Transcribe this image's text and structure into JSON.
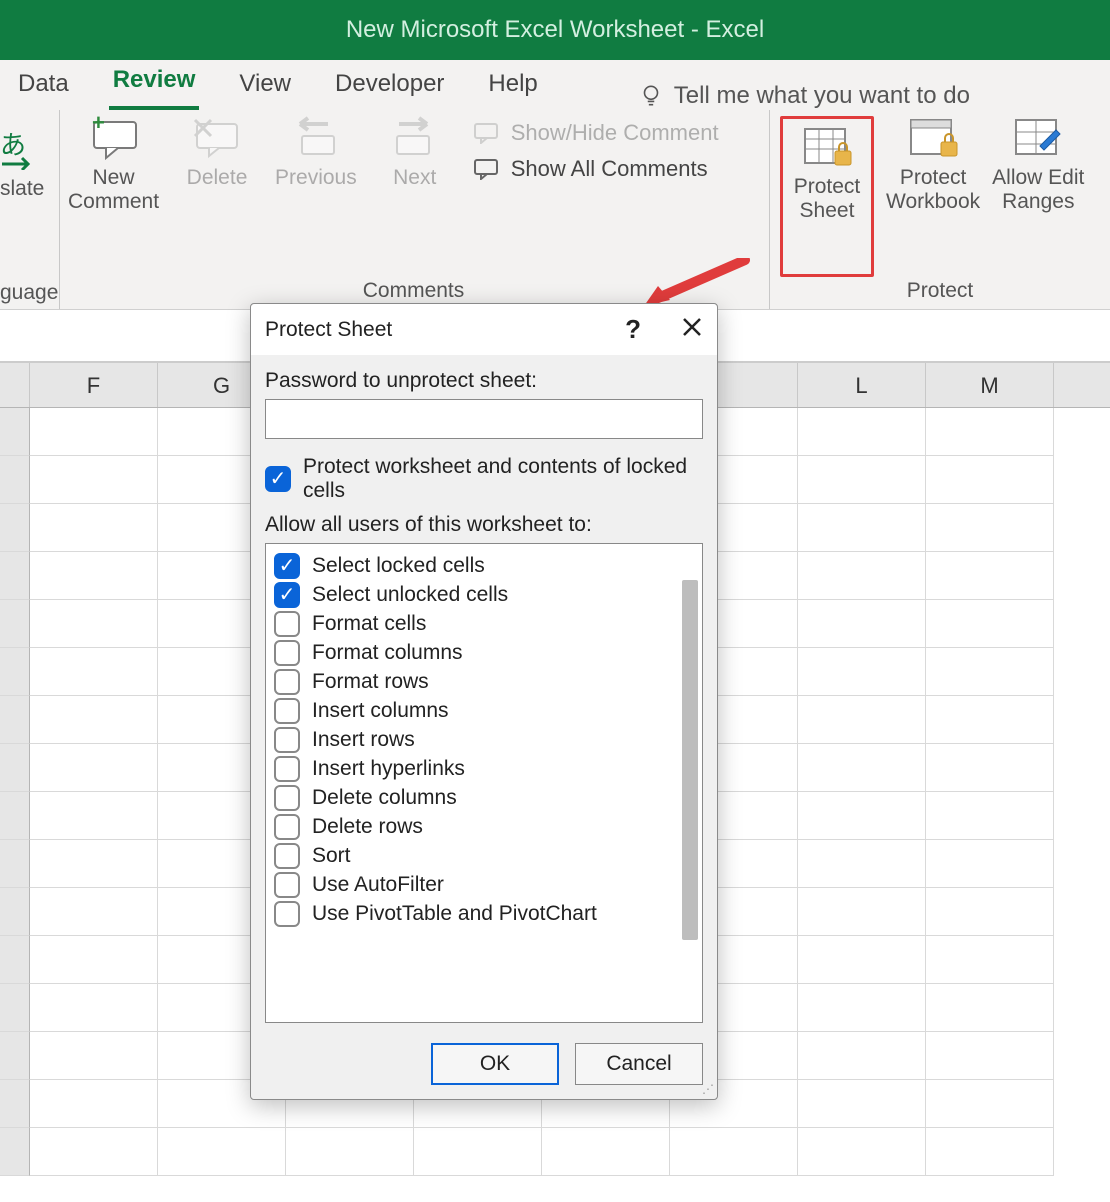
{
  "window": {
    "title": "New Microsoft Excel Worksheet  -  Excel"
  },
  "tabs": {
    "data": "Data",
    "review": "Review",
    "view": "View",
    "developer": "Developer",
    "help": "Help",
    "tellme": "Tell me what you want to do"
  },
  "ribbon": {
    "translate_partial": "slate",
    "language_caption_partial": "guage",
    "new_comment_line1": "New",
    "new_comment_line2": "Comment",
    "delete": "Delete",
    "previous": "Previous",
    "next": "Next",
    "show_hide": "Show/Hide Comment",
    "show_all": "Show All Comments",
    "comments_caption": "Comments",
    "protect_sheet_line1": "Protect",
    "protect_sheet_line2": "Sheet",
    "protect_workbook_line1": "Protect",
    "protect_workbook_line2": "Workbook",
    "allow_edit_line1": "Allow Edit",
    "allow_edit_line2": "Ranges",
    "protect_caption": "Protect"
  },
  "columns": [
    "F",
    "G",
    "",
    "",
    "",
    "",
    "L",
    "M"
  ],
  "dialog": {
    "title": "Protect Sheet",
    "help": "?",
    "password_label": "Password to unprotect sheet:",
    "protect_contents": "Protect worksheet and contents of locked cells",
    "allow_label": "Allow all users of this worksheet to:",
    "items": [
      {
        "label": "Select locked cells",
        "checked": true
      },
      {
        "label": "Select unlocked cells",
        "checked": true
      },
      {
        "label": "Format cells",
        "checked": false
      },
      {
        "label": "Format columns",
        "checked": false
      },
      {
        "label": "Format rows",
        "checked": false
      },
      {
        "label": "Insert columns",
        "checked": false
      },
      {
        "label": "Insert rows",
        "checked": false
      },
      {
        "label": "Insert hyperlinks",
        "checked": false
      },
      {
        "label": "Delete columns",
        "checked": false
      },
      {
        "label": "Delete rows",
        "checked": false
      },
      {
        "label": "Sort",
        "checked": false
      },
      {
        "label": "Use AutoFilter",
        "checked": false
      },
      {
        "label": "Use PivotTable and PivotChart",
        "checked": false
      }
    ],
    "ok": "OK",
    "cancel": "Cancel"
  }
}
